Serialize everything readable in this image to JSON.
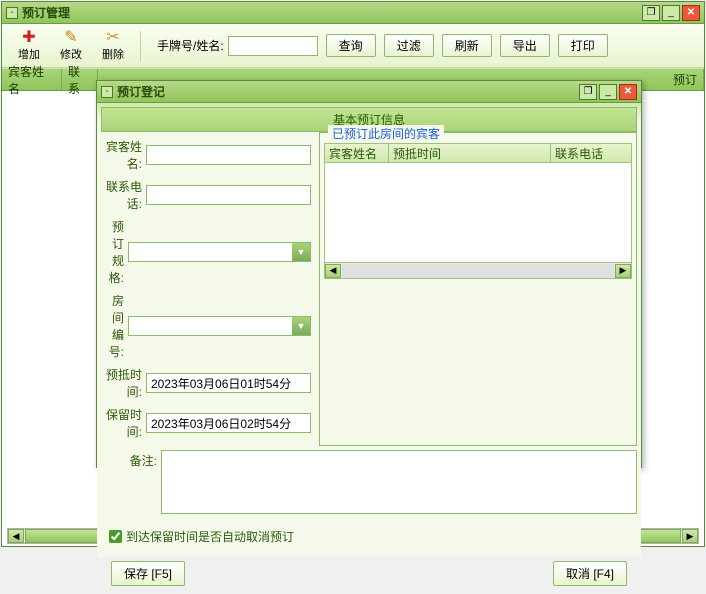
{
  "main": {
    "title": "预订管理",
    "toolbar": {
      "add": "增加",
      "modify": "修改",
      "delete": "删除",
      "search_label": "手牌号/姓名:",
      "query": "查询",
      "filter": "过滤",
      "refresh": "刷新",
      "export": "导出",
      "print": "打印"
    },
    "grid": {
      "cols": [
        "宾客姓名",
        "联系",
        "预订"
      ]
    }
  },
  "dialog": {
    "title": "预订登记",
    "section": "基本预订信息",
    "labels": {
      "guest": "宾客姓名:",
      "phone": "联系电话:",
      "spec": "预订规格:",
      "room": "房间编号:",
      "arrive": "预抵时间:",
      "hold": "保留时间:",
      "remark": "备注:"
    },
    "values": {
      "arrive": "2023年03月06日01时54分",
      "hold": "2023年03月06日02时54分"
    },
    "fieldset": {
      "legend": "已预订此房间的宾客",
      "cols": [
        "宾客姓名",
        "预抵时间",
        "联系电话"
      ]
    },
    "checkbox": "到达保留时间是否自动取消预订",
    "save_btn": "保存 [F5]",
    "cancel_btn": "取消 [F4]"
  }
}
